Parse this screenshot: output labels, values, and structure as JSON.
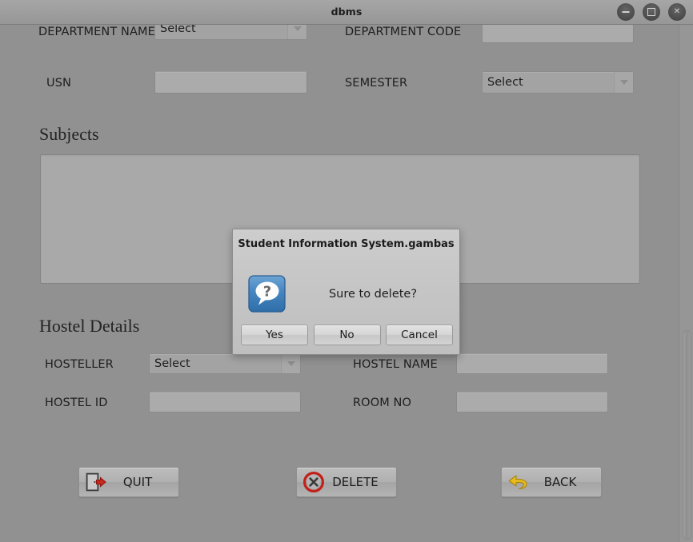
{
  "window": {
    "title": "dbms",
    "controls": [
      {
        "name": "minimize-button",
        "icon": "minimize-icon",
        "label": "Minimize"
      },
      {
        "name": "maximize-button",
        "icon": "maximize-icon",
        "label": "Maximize"
      },
      {
        "name": "close-button",
        "icon": "close-icon",
        "label": "Close"
      }
    ]
  },
  "form": {
    "fields": {
      "department_name": {
        "label": "DEPARTMENT NAME",
        "value": "Select",
        "type": "combobox"
      },
      "department_code": {
        "label": "DEPARTMENT CODE",
        "value": "",
        "type": "textbox"
      },
      "usn": {
        "label": "USN",
        "value": "",
        "type": "textbox"
      },
      "semester": {
        "label": "SEMESTER",
        "value": "Select",
        "type": "combobox"
      },
      "hosteller": {
        "label": "HOSTELLER",
        "value": "Select",
        "type": "combobox"
      },
      "hostel_name": {
        "label": "HOSTEL NAME",
        "value": "",
        "type": "textbox"
      },
      "hostel_id": {
        "label": "HOSTEL ID",
        "value": "",
        "type": "textbox"
      },
      "room_no": {
        "label": "ROOM NO",
        "value": "",
        "type": "textbox"
      }
    },
    "sections": {
      "subjects": {
        "title": "Subjects",
        "items": []
      },
      "hostel_details": {
        "title": "Hostel Details"
      }
    },
    "buttons": {
      "quit": {
        "label": "QUIT",
        "icon": "exit-door-icon",
        "accent": "#c8281e"
      },
      "delete": {
        "label": "DELETE",
        "icon": "delete-circle-x-icon",
        "accent": "#c22018"
      },
      "back": {
        "label": "BACK",
        "icon": "back-arrow-icon",
        "accent": "#e0b21a"
      }
    }
  },
  "dialog": {
    "title": "Student Information System.gambas",
    "message": "Sure to delete?",
    "icon": "question-speech-bubble-icon",
    "icon_color": "#3b82c4",
    "buttons": [
      {
        "name": "yes-button",
        "label": "Yes"
      },
      {
        "name": "no-button",
        "label": "No"
      },
      {
        "name": "cancel-button",
        "label": "Cancel"
      }
    ]
  },
  "theme": {
    "window_background": "#919191",
    "titlebar_background": "#9d9d9d",
    "dialog_background": "#c6c6c6",
    "field_background": "#ababab",
    "text_color": "#1e1e1e"
  }
}
